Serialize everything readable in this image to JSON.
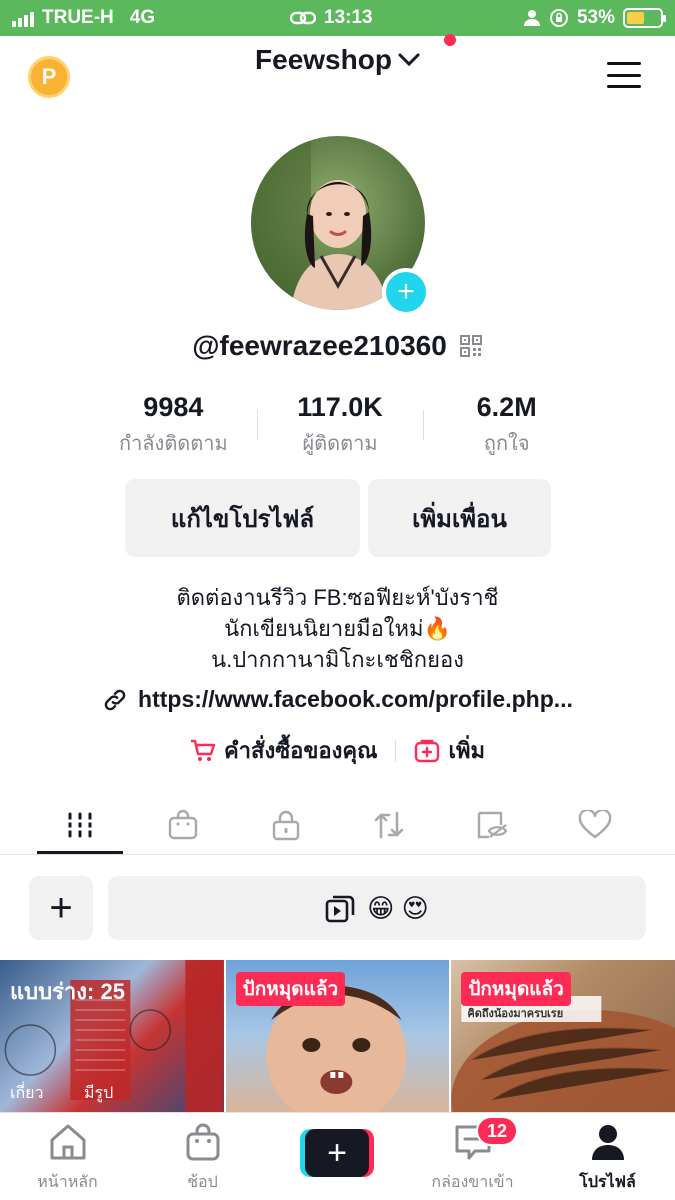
{
  "status_bar": {
    "carrier": "TRUE-H",
    "network": "4G",
    "time": "13:13",
    "battery_percent": "53%",
    "battery_level": 0.53,
    "battery_color": "#f7d046",
    "bar_color": "#5cb85c"
  },
  "header": {
    "account_name": "Feewshop",
    "coin_label": "P"
  },
  "profile": {
    "username": "@feewrazee210360",
    "stats": [
      {
        "value": "9984",
        "label": "กำลังติดตาม"
      },
      {
        "value": "117.0K",
        "label": "ผู้ติดตาม"
      },
      {
        "value": "6.2M",
        "label": "ถูกใจ"
      }
    ],
    "edit_profile_label": "แก้ไขโปรไฟล์",
    "add_friend_label": "เพิ่มเพื่อน",
    "bio_lines": [
      "ติดต่องานรีวิว FB:ซอฟียะห์'บังราชี",
      "นักเขียนนิยายมือใหม่🔥",
      "น.ปากกานามิโกะเชชิกยอง"
    ],
    "link": "https://www.facebook.com/profile.php...",
    "orders_label": "คำสั่งซื้อของคุณ",
    "add_label": "เพิ่ม"
  },
  "drafts": {
    "story_emojis": "😁 😍"
  },
  "grid": [
    {
      "overlay": "แบบร่าง: 25",
      "footer": "เกี่ยว",
      "footer2": "มีรูป"
    },
    {
      "pin": "ปักหมุดแล้ว"
    },
    {
      "pin": "ปักหมุดแล้ว",
      "caption": "คิดถึงน้องมาครบเรย"
    }
  ],
  "bottom_nav": {
    "home": "หน้าหลัก",
    "shop": "ช้อป",
    "inbox": "กล่องขาเข้า",
    "inbox_count": "12",
    "profile": "โปรไฟล์"
  },
  "colors": {
    "accent_red": "#fe2c55",
    "accent_cyan": "#20d5ec",
    "text_primary": "#161823",
    "text_secondary": "#8a8b91"
  },
  "icons": [
    "signal-icon",
    "link-chain-icon",
    "user-icon",
    "rotation-lock-icon",
    "battery-icon",
    "chevron-down-icon",
    "menu-icon",
    "qr-code-icon",
    "link-icon",
    "cart-icon",
    "add-box-icon",
    "videos-grid-icon",
    "shop-bag-icon",
    "lock-icon",
    "repost-icon",
    "hidden-icon",
    "heart-icon",
    "story-icon",
    "home-icon",
    "inbox-icon"
  ]
}
